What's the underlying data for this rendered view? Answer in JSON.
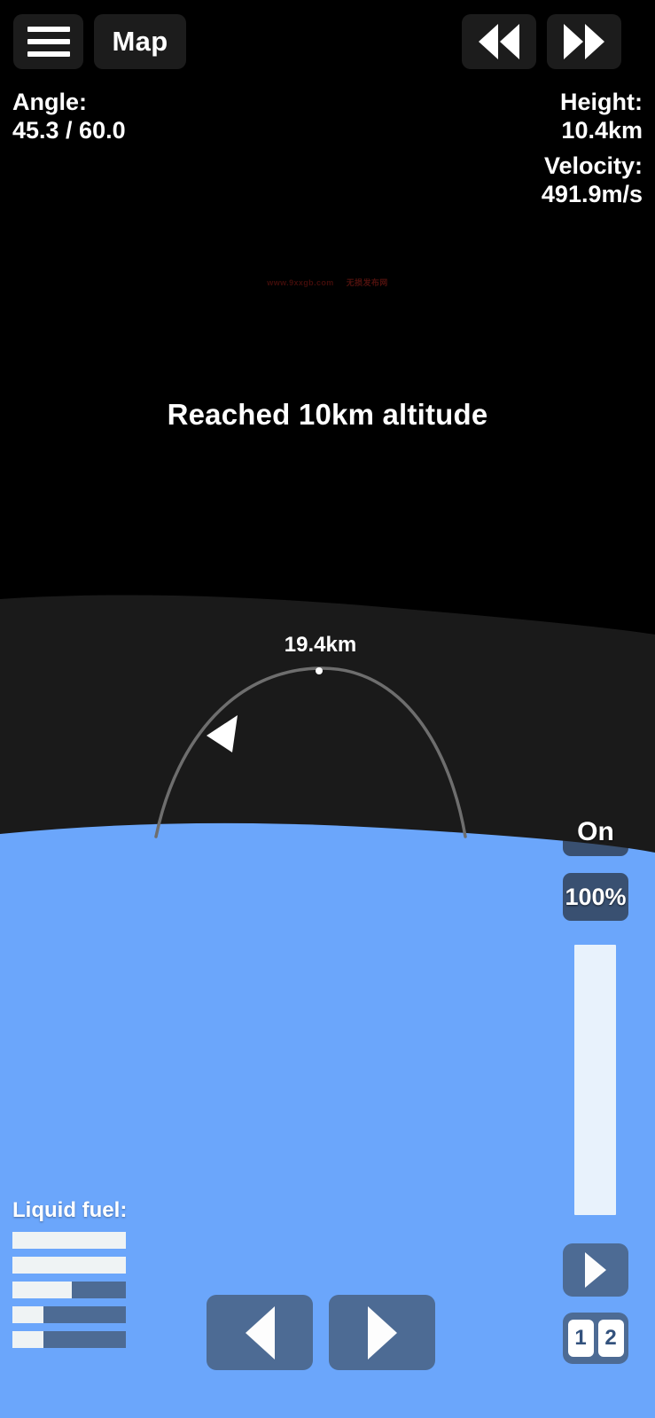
{
  "hud": {
    "menu_icon": "hamburger-menu-icon",
    "map_label": "Map",
    "rewind_icon": "rewind-double-left-icon",
    "forward_icon": "fast-forward-double-right-icon",
    "angle_label": "Angle:",
    "angle_value": "45.3 / 60.0",
    "height_label": "Height:",
    "height_value": "10.4km",
    "velocity_label": "Velocity:",
    "velocity_value": "491.9m/s"
  },
  "message": "Reached 10km altitude",
  "watermark": {
    "url": "www.9xxgb.com",
    "cjk": "无损发布网"
  },
  "map": {
    "apoapsis_label": "19.4km",
    "trajectory_color": "#6e6e6e",
    "apoapsis_dot_color": "#ffffff",
    "rocket_marker_color": "#ffffff",
    "space_color": "#000000",
    "atmosphere_color": "#1a1a1a",
    "planet_color": "#6ba6fb"
  },
  "controls": {
    "engine_state": "On",
    "throttle_percent_label": "100%",
    "throttle_percent_value": 100,
    "throttle_fill_color": "#e8f2fc",
    "stage_button_icon": "play-triangle-icon",
    "stage_chips": [
      "1",
      "2"
    ],
    "rotate_left_icon": "triangle-left-icon",
    "rotate_right_icon": "triangle-right-icon",
    "blue_button_color": "#4d6b94"
  },
  "fuel": {
    "label": "Liquid fuel:",
    "bars": [
      100,
      100,
      52,
      27,
      27
    ],
    "fill_color": "#eff3f4",
    "empty_color": "#4d6b94"
  }
}
